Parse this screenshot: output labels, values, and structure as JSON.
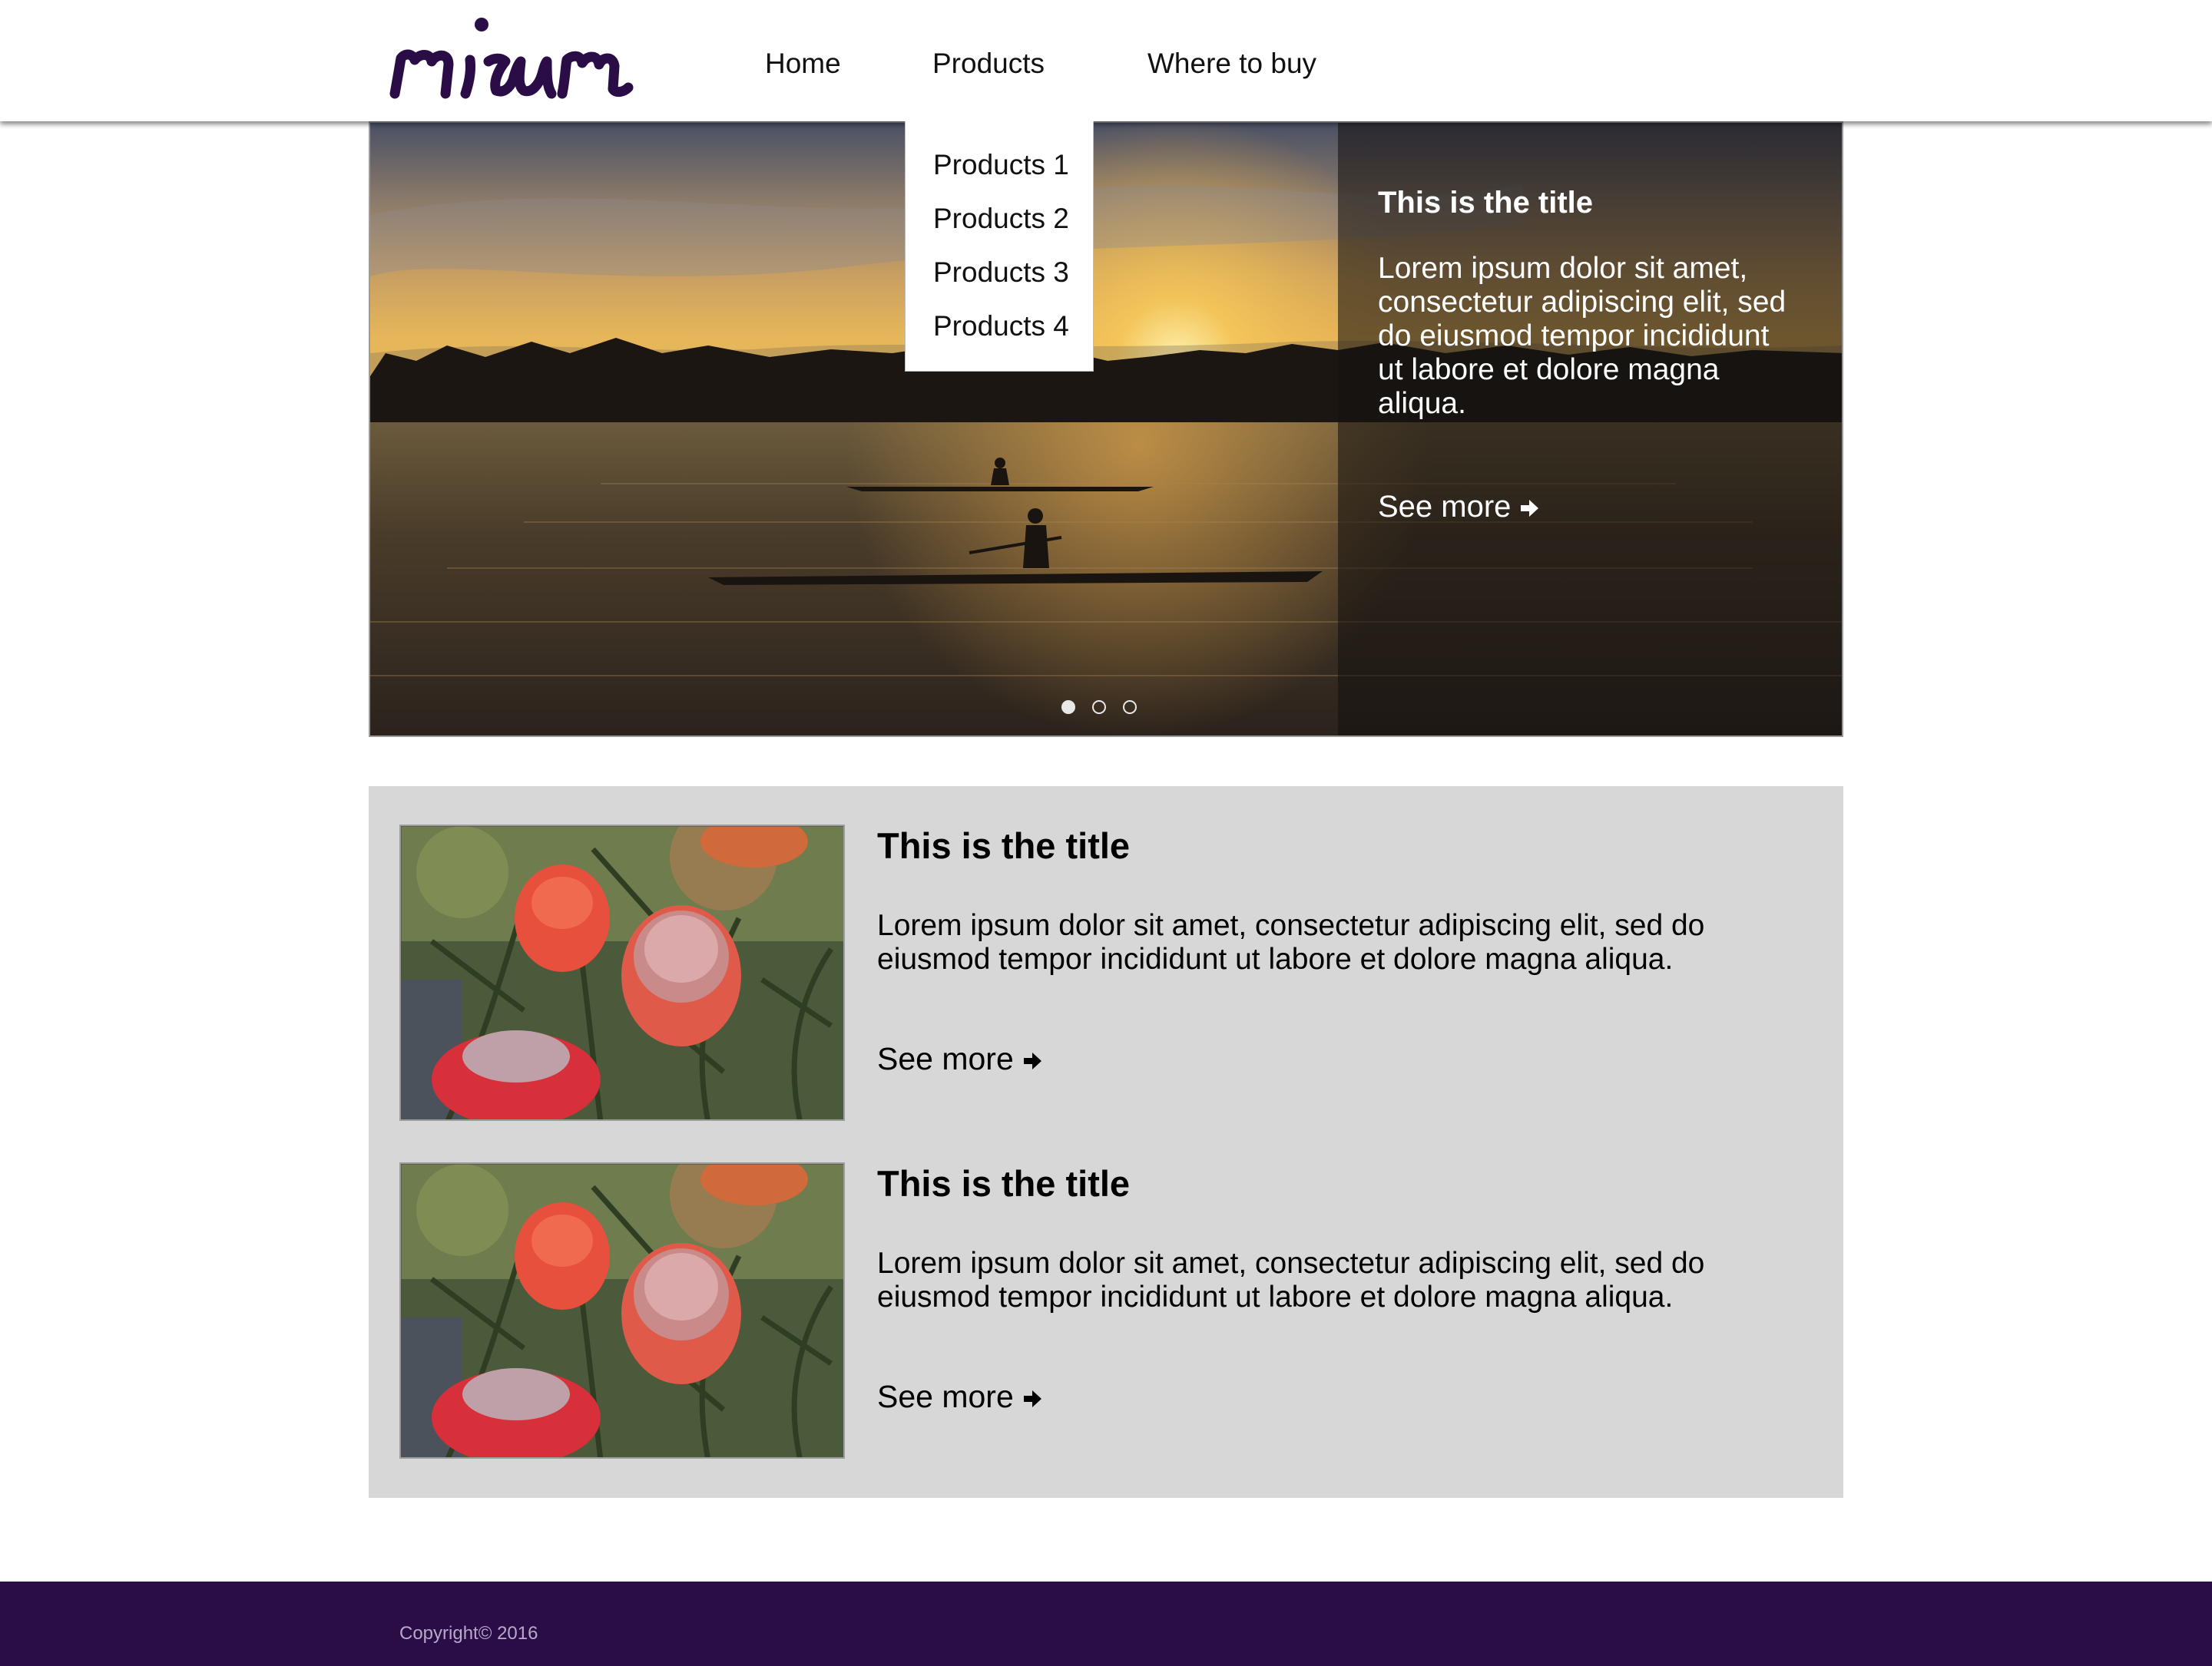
{
  "brand": {
    "logo_text": "mirum",
    "color": "#2a0c47"
  },
  "nav": {
    "items": [
      "Home",
      "Products",
      "Where to buy"
    ],
    "dropdown": [
      "Products 1",
      "Products 2",
      "Products 3",
      "Products 4"
    ]
  },
  "hero": {
    "title": "This is the title",
    "body": "Lorem ipsum dolor sit amet, consectetur adipiscing elit, sed do eiusmod tempor incididunt ut labore et dolore magna aliqua.",
    "see_more": "See more",
    "slides_total": 3,
    "slide_active": 1
  },
  "cards": [
    {
      "title": "This is the title",
      "body": "Lorem ipsum dolor sit amet, consectetur adipiscing elit, sed do eiusmod tempor incididunt ut labore et dolore magna aliqua.",
      "see_more": "See more"
    },
    {
      "title": "This is the title",
      "body": "Lorem ipsum dolor sit amet, consectetur adipiscing elit, sed do eiusmod tempor incididunt ut labore et dolore magna aliqua.",
      "see_more": "See more"
    }
  ],
  "footer": {
    "copyright": "Copyright© 2016"
  },
  "icons": {
    "see_more": "arrow-right-icon"
  },
  "colors": {
    "cards_bg": "#d7d7d7",
    "footer_bg": "#2a0c47"
  }
}
